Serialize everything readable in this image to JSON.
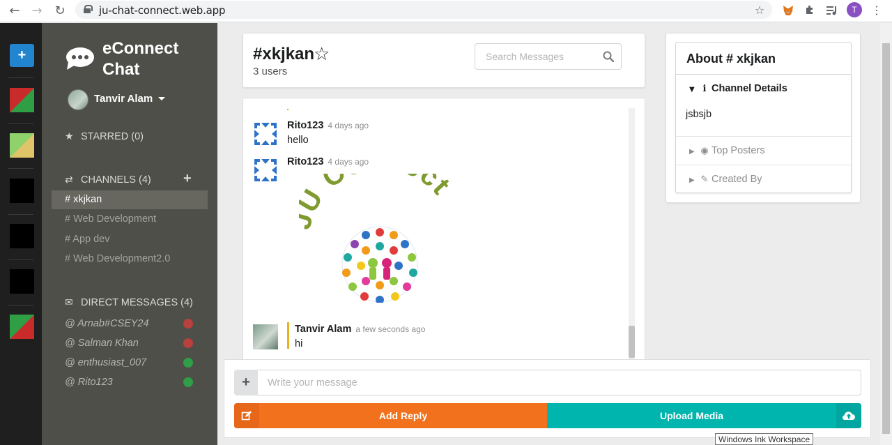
{
  "browser": {
    "url": "ju-chat-connect.web.app",
    "back_icon": "back-arrow-icon",
    "forward_icon": "forward-arrow-icon",
    "reload_icon": "reload-icon",
    "profile_initial": "T"
  },
  "color_panel": {
    "add_label": "+",
    "swatches": [
      {
        "primary": "#2f9e44",
        "secondary": "#c92a2a"
      },
      {
        "primary": "#e0c46a",
        "secondary": "#8fd26b"
      },
      {
        "primary": "#000000",
        "secondary": "#000000"
      },
      {
        "primary": "#000000",
        "secondary": "#000000"
      },
      {
        "primary": "#000000",
        "secondary": "#000000"
      },
      {
        "primary": "#c92a2a",
        "secondary": "#2f9e44"
      }
    ]
  },
  "sidebar": {
    "app_name": "eConnect Chat",
    "user_name": "Tanvir Alam",
    "starred_label": "STARRED (0)",
    "channels_label": "CHANNELS (4)",
    "channels": [
      {
        "label": "# xkjkan",
        "active": true
      },
      {
        "label": "# Web Development",
        "active": false
      },
      {
        "label": "# App dev",
        "active": false
      },
      {
        "label": "# Web Development2.0",
        "active": false
      }
    ],
    "dm_label": "DIRECT MESSAGES (4)",
    "direct_messages": [
      {
        "label": "@ Arnab#CSEY24",
        "status": "offline"
      },
      {
        "label": "@ Salman Khan",
        "status": "offline"
      },
      {
        "label": "@ enthusiast_007",
        "status": "online"
      },
      {
        "label": "@ Rito123",
        "status": "online"
      }
    ]
  },
  "header": {
    "channel_title": "#xkjkan",
    "user_count": "3 users",
    "search_placeholder": "Search Messages"
  },
  "messages": [
    {
      "author": "Rito123",
      "time": "4 days ago",
      "text": "hello"
    },
    {
      "author": "Rito123",
      "time": "4 days ago",
      "image_text": "JU Connect"
    },
    {
      "author": "Tanvir Alam",
      "time": "a few seconds ago",
      "text": "hi"
    }
  ],
  "compose": {
    "plus_label": "+",
    "placeholder": "Write your message",
    "reply_label": "Add Reply",
    "upload_label": "Upload Media"
  },
  "about": {
    "title": "About # xkjkan",
    "details_label": "Channel Details",
    "details_text": "jsbsjb",
    "top_posters_label": "Top Posters",
    "created_by_label": "Created By"
  },
  "tooltip": "Windows Ink Workspace",
  "colors": {
    "sidebar_bg": "#4f4f4a",
    "panel_bg": "#1f1f1f",
    "reply": "#f2711c",
    "upload": "#00b5ad",
    "accent_blue": "#2185d0"
  }
}
